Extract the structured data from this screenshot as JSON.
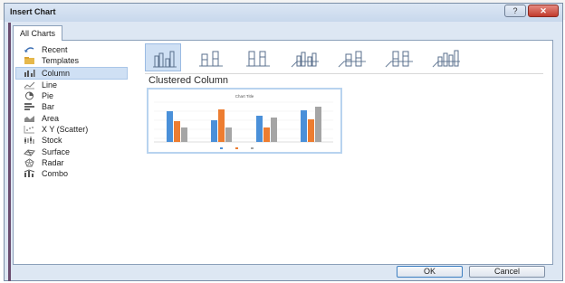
{
  "window": {
    "title": "Insert Chart"
  },
  "tabs": [
    {
      "label": "All Charts"
    }
  ],
  "sidebar": {
    "items": [
      {
        "label": "Recent",
        "icon": "recent-icon"
      },
      {
        "label": "Templates",
        "icon": "folder-icon"
      },
      {
        "label": "Column",
        "icon": "column-chart-icon",
        "selected": true
      },
      {
        "label": "Line",
        "icon": "line-chart-icon"
      },
      {
        "label": "Pie",
        "icon": "pie-chart-icon"
      },
      {
        "label": "Bar",
        "icon": "bar-chart-icon"
      },
      {
        "label": "Area",
        "icon": "area-chart-icon"
      },
      {
        "label": "X Y (Scatter)",
        "icon": "scatter-chart-icon"
      },
      {
        "label": "Stock",
        "icon": "stock-chart-icon"
      },
      {
        "label": "Surface",
        "icon": "surface-chart-icon"
      },
      {
        "label": "Radar",
        "icon": "radar-chart-icon"
      },
      {
        "label": "Combo",
        "icon": "combo-chart-icon"
      }
    ]
  },
  "subtypes": [
    {
      "name": "clustered-column",
      "selected": true
    },
    {
      "name": "stacked-column"
    },
    {
      "name": "100-stacked-column"
    },
    {
      "name": "3d-clustered-column"
    },
    {
      "name": "3d-stacked-column"
    },
    {
      "name": "3d-100-stacked-column"
    },
    {
      "name": "3d-column"
    }
  ],
  "selected_subtype_title": "Clustered Column",
  "preview": {
    "title": "Chart Title",
    "series_colors": [
      "#4a90d9",
      "#ed7d31",
      "#a5a5a5"
    ]
  },
  "buttons": {
    "ok": "OK",
    "cancel": "Cancel"
  },
  "colors": {
    "accent": "#cfe0f4",
    "titlebar": "#c8d8ec",
    "close": "#c13b2c"
  }
}
